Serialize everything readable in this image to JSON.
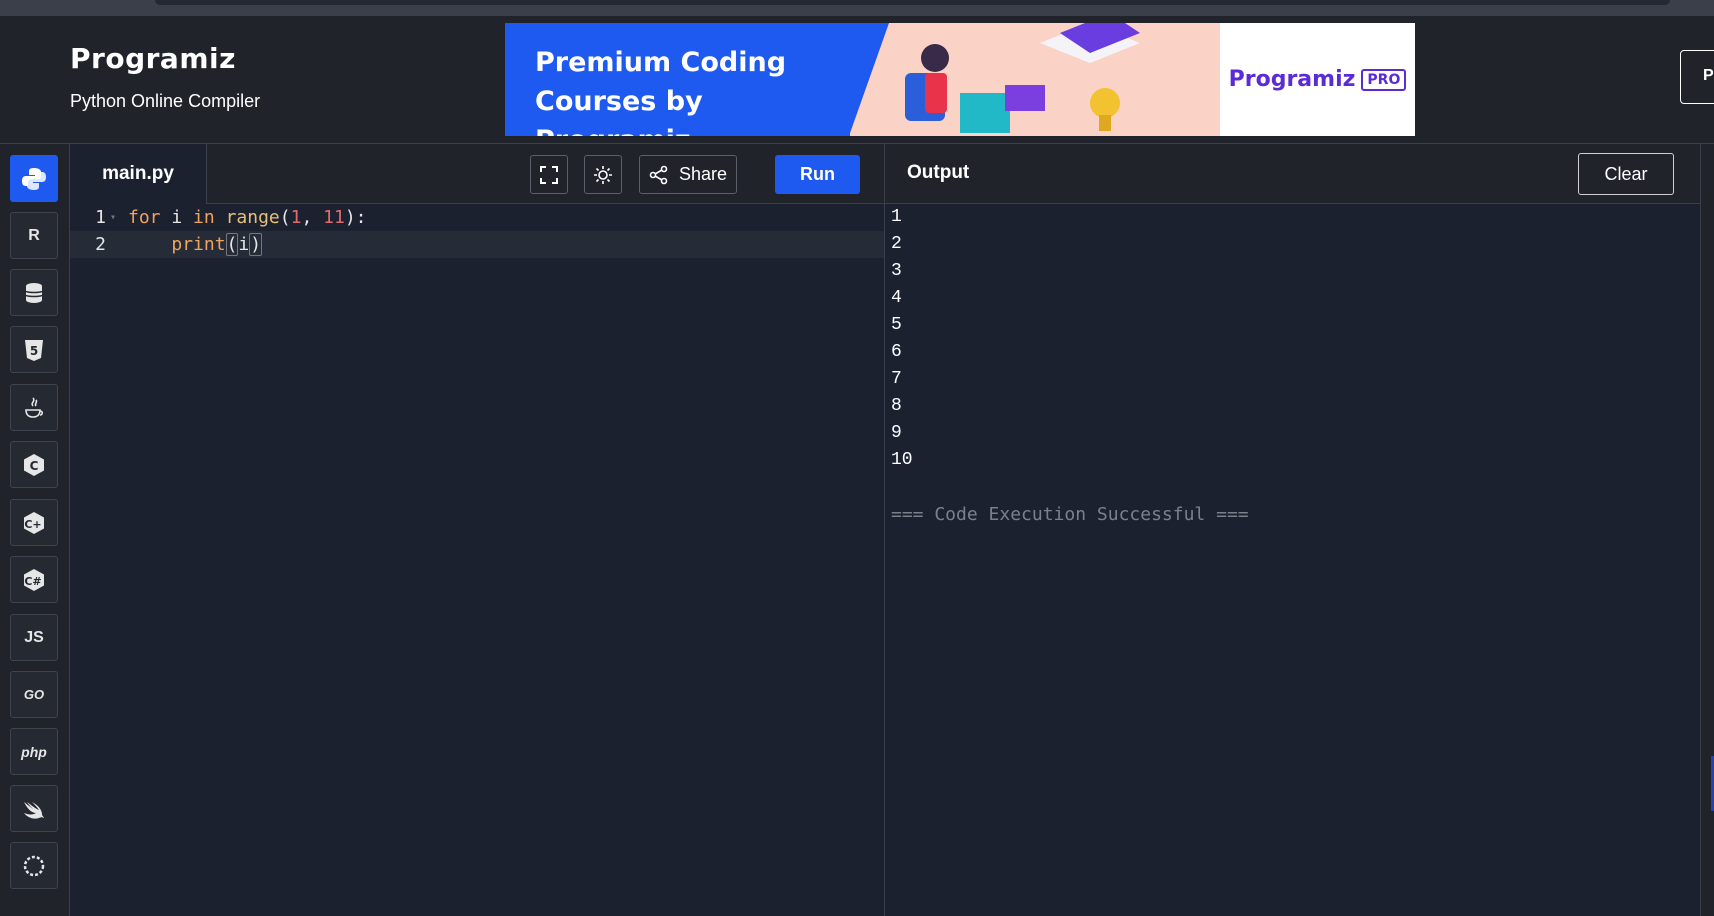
{
  "header": {
    "logo": "Programiz",
    "subtitle": "Python Online Compiler",
    "banner": {
      "line1": "Premium Coding",
      "line2": "Courses by Programiz",
      "brand": "Programiz",
      "tag": "PRO"
    },
    "edge_button": "P"
  },
  "sidebar": {
    "items": [
      {
        "name": "python",
        "icon": "python-icon",
        "label": ""
      },
      {
        "name": "r",
        "icon": "r-icon",
        "label": "R"
      },
      {
        "name": "sql",
        "icon": "database-icon",
        "label": ""
      },
      {
        "name": "html",
        "icon": "html5-icon",
        "label": "5"
      },
      {
        "name": "java",
        "icon": "java-icon",
        "label": ""
      },
      {
        "name": "c",
        "icon": "c-icon",
        "label": "C"
      },
      {
        "name": "cpp",
        "icon": "cpp-icon",
        "label": "C+"
      },
      {
        "name": "csharp",
        "icon": "csharp-icon",
        "label": "C#"
      },
      {
        "name": "javascript",
        "icon": "js-icon",
        "label": "JS"
      },
      {
        "name": "go",
        "icon": "go-icon",
        "label": "GO"
      },
      {
        "name": "php",
        "icon": "php-icon",
        "label": "php"
      },
      {
        "name": "swift",
        "icon": "swift-icon",
        "label": ""
      }
    ]
  },
  "editor": {
    "tab": "main.py",
    "share_label": "Share",
    "run_label": "Run",
    "lines": [
      {
        "num": "1",
        "code": "for i in range(1, 11):"
      },
      {
        "num": "2",
        "code": "    print(i)"
      }
    ]
  },
  "output": {
    "title": "Output",
    "clear_label": "Clear",
    "lines": [
      "1",
      "2",
      "3",
      "4",
      "5",
      "6",
      "7",
      "8",
      "9",
      "10"
    ],
    "status": "=== Code Execution Successful ==="
  },
  "colors": {
    "accent": "#1f5af0",
    "background": "#1c2130",
    "panel": "#20232a",
    "keyword": "#f0a45d",
    "number": "#e06c6c"
  }
}
